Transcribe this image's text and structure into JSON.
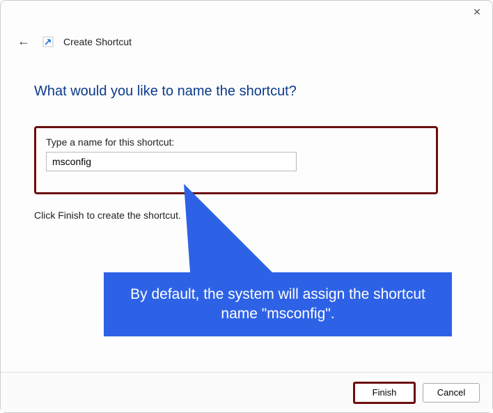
{
  "titlebar": {
    "close_glyph": "✕"
  },
  "header": {
    "back_glyph": "←",
    "title": "Create Shortcut",
    "icon_name": "shortcut-arrow-icon"
  },
  "content": {
    "question": "What would you like to name the shortcut?",
    "input_label": "Type a name for this shortcut:",
    "input_value": "msconfig",
    "hint": "Click Finish to create the shortcut."
  },
  "callout": {
    "text": "By default, the system will assign the shortcut name \"msconfig\"."
  },
  "footer": {
    "finish_label": "Finish",
    "cancel_label": "Cancel"
  },
  "colors": {
    "accent": "#0a3a8a",
    "highlight_border": "#6b0e0e",
    "callout_bg": "#2e62e6"
  }
}
